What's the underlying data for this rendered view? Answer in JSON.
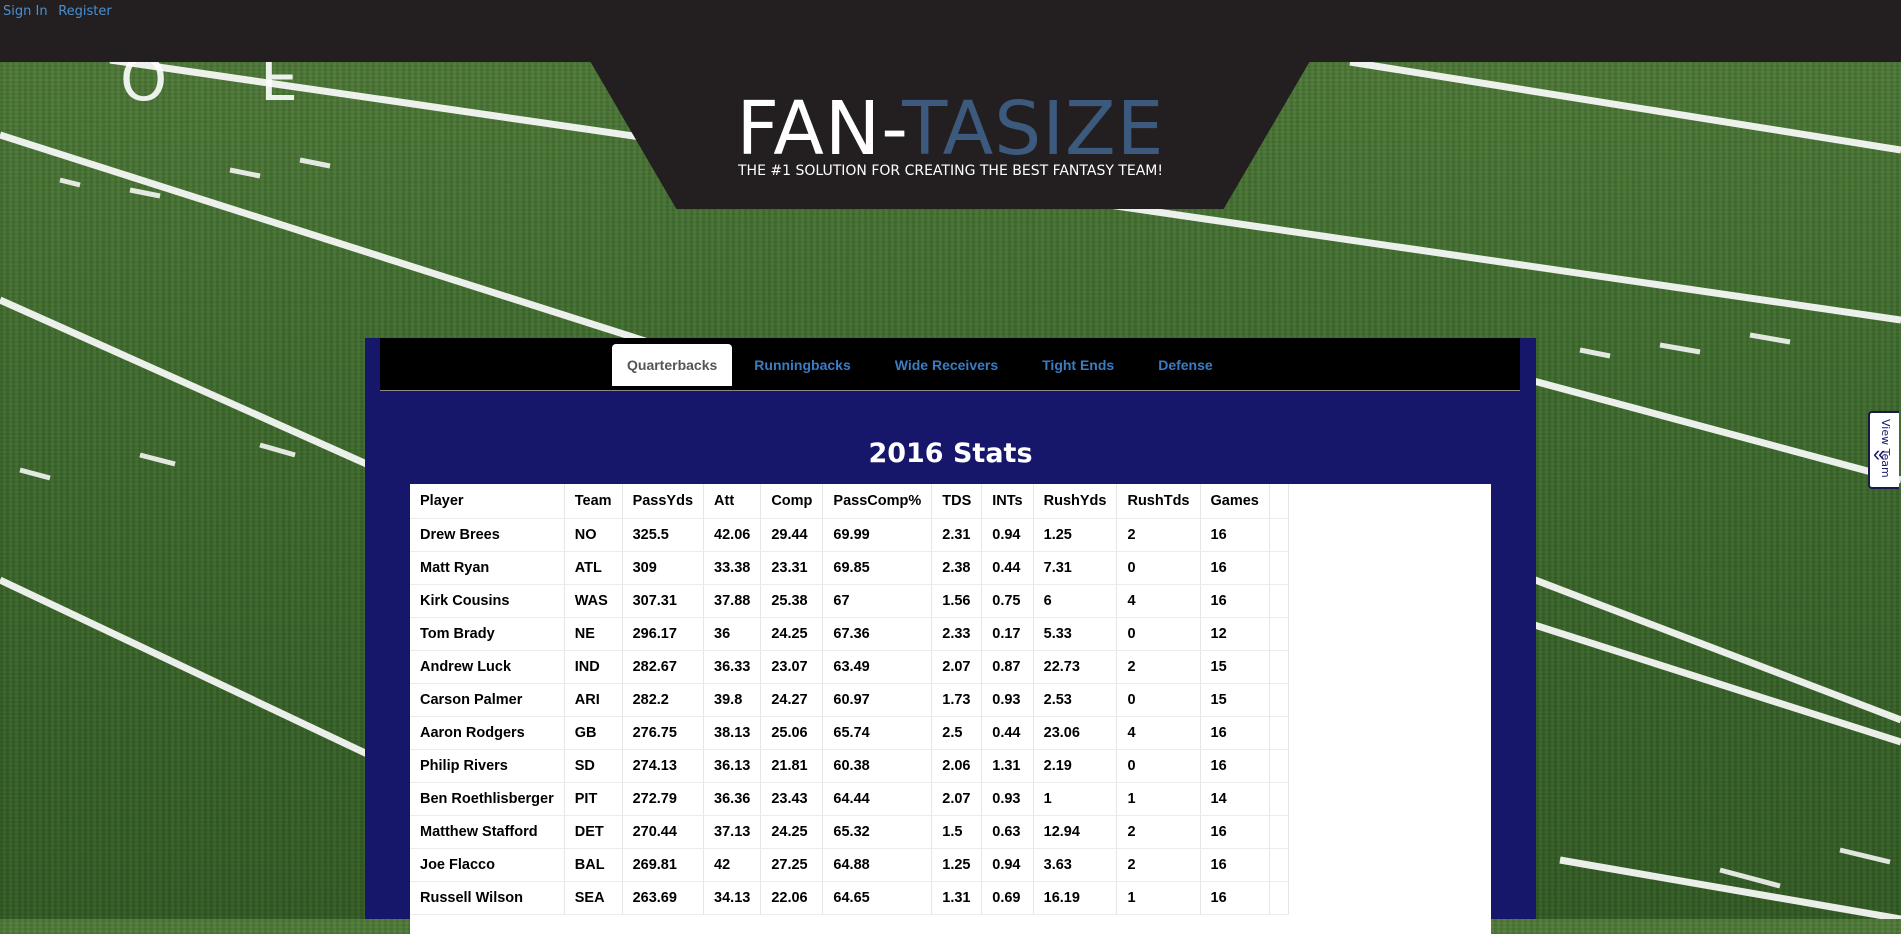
{
  "auth": {
    "sign_in": "Sign In",
    "register": "Register"
  },
  "logo": {
    "part1": "FAN-",
    "part2": "TASIZE",
    "tagline": "THE #1 SOLUTION FOR CREATING THE BEST FANTASY TEAM!"
  },
  "tabs": [
    {
      "label": "Quarterbacks",
      "active": true
    },
    {
      "label": "Runningbacks"
    },
    {
      "label": "Wide Receivers"
    },
    {
      "label": "Tight Ends"
    },
    {
      "label": "Defense"
    }
  ],
  "stats": {
    "title": "2016 Stats",
    "columns": [
      "Player",
      "Team",
      "PassYds",
      "Att",
      "Comp",
      "PassComp%",
      "TDS",
      "INTs",
      "RushYds",
      "RushTds",
      "Games"
    ],
    "rows": [
      [
        "Drew Brees",
        "NO",
        "325.5",
        "42.06",
        "29.44",
        "69.99",
        "2.31",
        "0.94",
        "1.25",
        "2",
        "16"
      ],
      [
        "Matt Ryan",
        "ATL",
        "309",
        "33.38",
        "23.31",
        "69.85",
        "2.38",
        "0.44",
        "7.31",
        "0",
        "16"
      ],
      [
        "Kirk Cousins",
        "WAS",
        "307.31",
        "37.88",
        "25.38",
        "67",
        "1.56",
        "0.75",
        "6",
        "4",
        "16"
      ],
      [
        "Tom Brady",
        "NE",
        "296.17",
        "36",
        "24.25",
        "67.36",
        "2.33",
        "0.17",
        "5.33",
        "0",
        "12"
      ],
      [
        "Andrew Luck",
        "IND",
        "282.67",
        "36.33",
        "23.07",
        "63.49",
        "2.07",
        "0.87",
        "22.73",
        "2",
        "15"
      ],
      [
        "Carson Palmer",
        "ARI",
        "282.2",
        "39.8",
        "24.27",
        "60.97",
        "1.73",
        "0.93",
        "2.53",
        "0",
        "15"
      ],
      [
        "Aaron Rodgers",
        "GB",
        "276.75",
        "38.13",
        "25.06",
        "65.74",
        "2.5",
        "0.44",
        "23.06",
        "4",
        "16"
      ],
      [
        "Philip Rivers",
        "SD",
        "274.13",
        "36.13",
        "21.81",
        "60.38",
        "2.06",
        "1.31",
        "2.19",
        "0",
        "16"
      ],
      [
        "Ben Roethlisberger",
        "PIT",
        "272.79",
        "36.36",
        "23.43",
        "64.44",
        "2.07",
        "0.93",
        "1",
        "1",
        "14"
      ],
      [
        "Matthew Stafford",
        "DET",
        "270.44",
        "37.13",
        "24.25",
        "65.32",
        "1.5",
        "0.63",
        "12.94",
        "2",
        "16"
      ],
      [
        "Joe Flacco",
        "BAL",
        "269.81",
        "42",
        "27.25",
        "64.88",
        "1.25",
        "0.94",
        "3.63",
        "2",
        "16"
      ],
      [
        "Russell Wilson",
        "SEA",
        "263.69",
        "34.13",
        "22.06",
        "64.65",
        "1.31",
        "0.69",
        "16.19",
        "1",
        "16"
      ]
    ]
  },
  "view_team": {
    "label": "View Team"
  }
}
